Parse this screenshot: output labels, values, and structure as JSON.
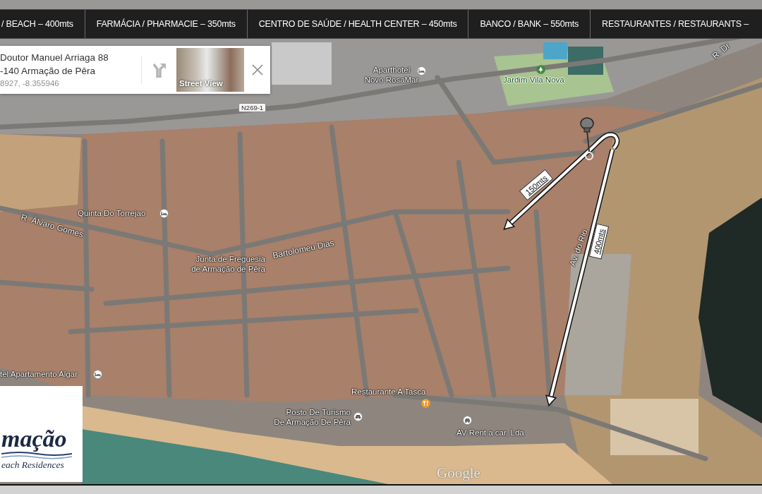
{
  "nav_bar": {
    "items": [
      {
        "label": "/ BEACH – 400mts"
      },
      {
        "label": "FARMÁCIA / PHARMACIE – 350mts"
      },
      {
        "label": "CENTRO DE SAÚDE / HEALTH CENTER – 450mts"
      },
      {
        "label": "BANCO / BANK – 550mts"
      },
      {
        "label": "RESTAURANTES / RESTAURANTS –"
      }
    ]
  },
  "place_card": {
    "address_lines": [
      "Doutor Manuel Arriaga 88",
      "-140 Armação de Pêra"
    ],
    "coordinates": "8927, -8.355946",
    "street_view": {
      "label": "Street View"
    }
  },
  "map": {
    "road_shield": "N269-1",
    "places": [
      {
        "kind": "hotel",
        "lines": [
          "Aparthotel",
          "Novo RosaMar"
        ]
      },
      {
        "kind": "park",
        "lines": [
          "Jardim Vila Nova"
        ]
      },
      {
        "kind": "hotel",
        "lines": [
          "Quinta Do Torrejao"
        ]
      },
      {
        "kind": "civic",
        "lines": [
          "Junta de Freguesia",
          "de Armação de Pêra"
        ]
      },
      {
        "kind": "hotel",
        "lines": [
          "tel Apartamento Algar"
        ]
      },
      {
        "kind": "restaurant",
        "lines": [
          "Restaurante A Tasca"
        ]
      },
      {
        "kind": "tourism",
        "lines": [
          "Posto De Turismo",
          "De Armação De Pêra"
        ]
      },
      {
        "kind": "car_rental",
        "lines": [
          "AV Rent a car, Lda"
        ]
      }
    ],
    "streets": [
      "R. Dr",
      "R. Álvaro Gomes",
      "Bartolomeu Dias",
      "Av. do Rio"
    ],
    "routes": [
      {
        "distance": "150mts"
      },
      {
        "distance": "400mts"
      }
    ],
    "attribution": "Google"
  },
  "logo": {
    "wordmark": "mação",
    "tagline": "each Residences"
  }
}
